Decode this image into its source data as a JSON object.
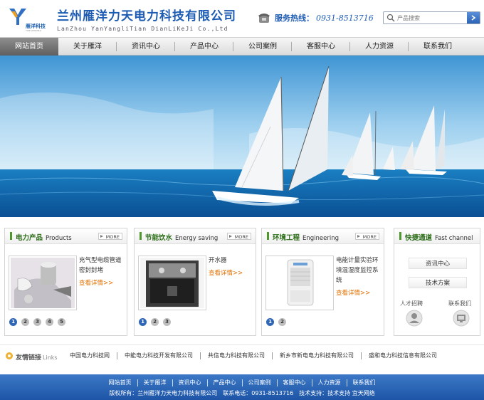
{
  "header": {
    "logo_text": "雁洋科技",
    "logo_sub": "YANYANGKEJI",
    "company_name": "兰州雁洋力天电力科技有限公司",
    "company_en": "LanZhou YanYangliTian DianLiKeJi Co.,Ltd",
    "hotline_label": "服务热线：",
    "hotline_number": "0931-8513716",
    "search_placeholder": "产品搜索"
  },
  "nav": {
    "items": [
      "网站首页",
      "关于雁洋",
      "资讯中心",
      "产品中心",
      "公司案例",
      "客服中心",
      "人力资源",
      "联系我们"
    ],
    "active": "网站首页"
  },
  "panels": [
    {
      "title": "电力产品",
      "title_en": "Products",
      "more": "MORE",
      "product": "充气型电缆管道密封封堵",
      "detail": "查看详情>>",
      "pages": [
        "1",
        "2",
        "3",
        "4",
        "5"
      ]
    },
    {
      "title": "节能饮水",
      "title_en": "Energy saving",
      "more": "MORE",
      "product": "开水器",
      "detail": "查看详情>>",
      "pages": [
        "1",
        "2",
        "3"
      ]
    },
    {
      "title": "环境工程",
      "title_en": "Engineering",
      "more": "MORE",
      "product": "电能计量实验环境温湿度监控系统",
      "detail": "查看详情>>",
      "pages": [
        "1",
        "2"
      ]
    }
  ],
  "quick": {
    "title": "快捷通道",
    "title_en": "Fast channel",
    "buttons": [
      "资讯中心",
      "技术方案"
    ],
    "recruit_label": "人才招聘",
    "contact_label": "联系我们"
  },
  "links": {
    "title": "友情链接",
    "title_en": "Links",
    "items": [
      "中国电力科技网",
      "中能电力科技开发有限公司",
      "共信电力科技有限公司",
      "新乡市新电电力科技有限公司",
      "盛和电力科技信息有限公司"
    ]
  },
  "footer": {
    "nav": [
      "网站首页",
      "关于雁洋",
      "资讯中心",
      "产品中心",
      "公司案例",
      "客服中心",
      "人力资源",
      "联系我们"
    ],
    "copyright": "版权所有：兰州雁洋力天电力科技有限公司　联系电话：0931-8513716　技术支持：技术支持 宜天网络"
  },
  "colors": {
    "brand_blue": "#1e5cb3",
    "green": "#4d9a2a",
    "orange": "#e07000"
  }
}
